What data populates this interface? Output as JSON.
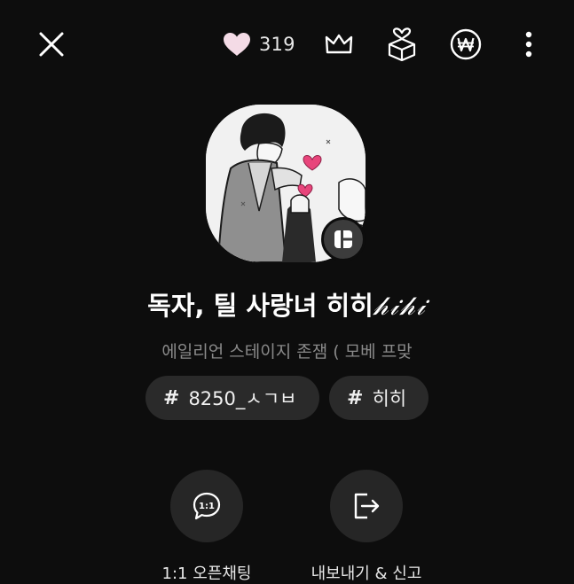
{
  "header": {
    "like_count": "319",
    "icons": [
      "close-icon",
      "heart-icon",
      "crown-icon",
      "gift-box-icon",
      "won-icon",
      "more-vertical-icon"
    ]
  },
  "profile": {
    "title_main": "독자, 틸 사랑녀 히히",
    "title_deco": "𝒽𝒾𝒽𝒾",
    "subtitle": "에일리언 스테이지 존잼 ( 모베 프맞"
  },
  "tags": [
    {
      "label": "8250_ㅅㄱㅂ"
    },
    {
      "label": "히히"
    }
  ],
  "actions": [
    {
      "label": "1:1 오픈채팅",
      "icon": "chat-bubble-icon",
      "icon_text": "1:1"
    },
    {
      "label": "내보내기 & 신고",
      "icon": "exit-icon"
    }
  ],
  "colors": {
    "background": "#0d0d0d",
    "chip": "#2a2a2a",
    "action_circle": "#262626",
    "subtitle": "#8a8a8a",
    "accent_pink": "#e8457b"
  }
}
